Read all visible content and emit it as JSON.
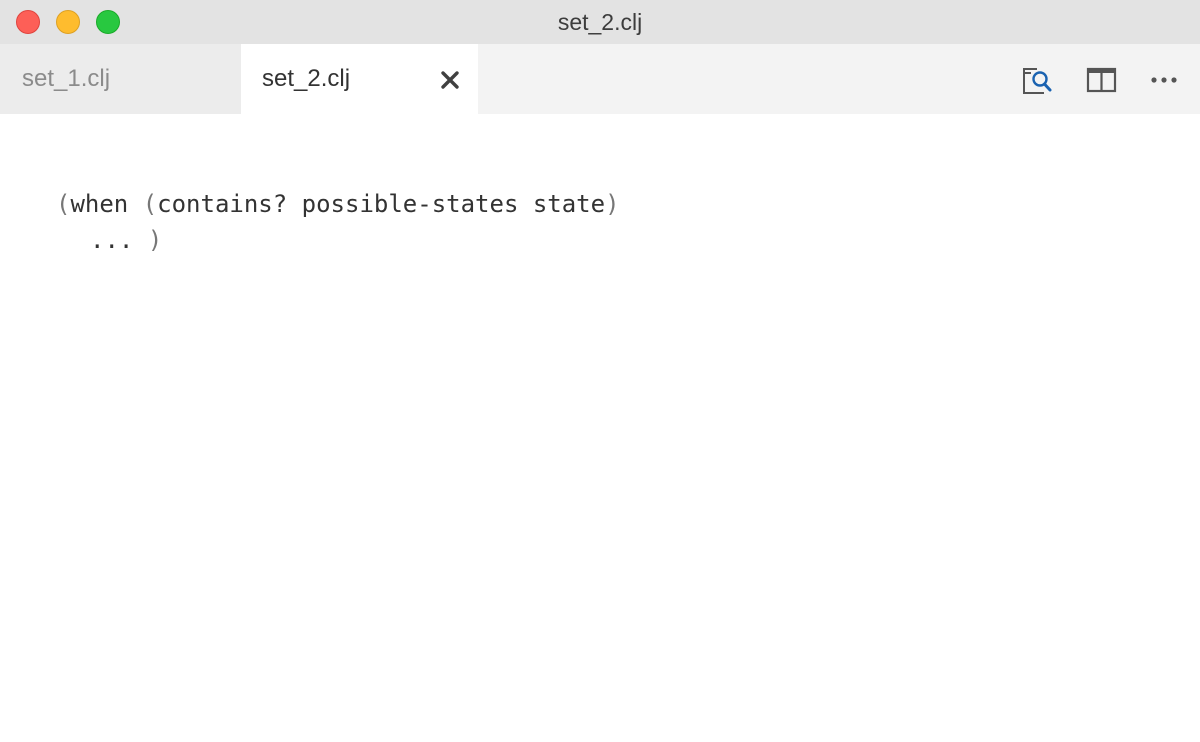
{
  "window": {
    "title": "set_2.clj"
  },
  "tabs": [
    {
      "label": "set_1.clj",
      "active": false
    },
    {
      "label": "set_2.clj",
      "active": true
    }
  ],
  "toolbar": {
    "icons": [
      "open-preview-icon",
      "split-editor-icon",
      "more-actions-icon"
    ]
  },
  "editor": {
    "lines": [
      {
        "open": "(",
        "text": "when ",
        "open2": "(",
        "text2": "contains? possible-states state",
        "close": ")"
      },
      {
        "ellipsis": "...",
        "close": ")"
      }
    ]
  },
  "colors": {
    "accent": "#1a62b0",
    "titlebar": "#e3e3e3",
    "tabbar": "#f3f3f3"
  }
}
